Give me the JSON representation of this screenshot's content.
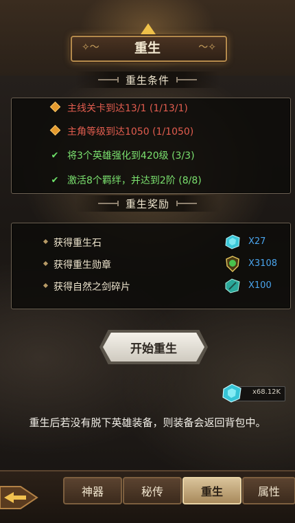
{
  "header": {
    "title": "重生"
  },
  "conditions": {
    "heading": "重生条件",
    "items": [
      {
        "text": "主线关卡到达13/1 (1/13/1)",
        "status": "unmet",
        "icon": "diamond-icon"
      },
      {
        "text": "主角等级到达1050 (1/1050)",
        "status": "unmet",
        "icon": "diamond-icon"
      },
      {
        "text": "将3个英雄强化到420级 (3/3)",
        "status": "met",
        "icon": "check-icon"
      },
      {
        "text": "激活8个羁绊，并达到2阶 (8/8)",
        "status": "met",
        "icon": "check-icon"
      }
    ]
  },
  "rewards": {
    "heading": "重生奖励",
    "items": [
      {
        "label": "获得重生石",
        "icon": "rebirth-stone-icon",
        "amount": "X27"
      },
      {
        "label": "获得重生勋章",
        "icon": "rebirth-medal-icon",
        "amount": "X3108"
      },
      {
        "label": "获得自然之剑碎片",
        "icon": "nature-sword-shard-icon",
        "amount": "X100"
      }
    ]
  },
  "start_button": {
    "label": "开始重生"
  },
  "currency": {
    "icon": "rebirth-stone-icon",
    "value": "x68.12K"
  },
  "notice": "重生后若没有脱下英雄装备，则装备会返回背包中。",
  "tabs": [
    {
      "label": "神器",
      "active": false
    },
    {
      "label": "秘传",
      "active": false
    },
    {
      "label": "重生",
      "active": true
    },
    {
      "label": "属性",
      "active": false
    }
  ],
  "colors": {
    "unmet": "#e35d4f",
    "met": "#7be26f",
    "amount": "#4aa5ee",
    "accent": "#f0c34a"
  }
}
